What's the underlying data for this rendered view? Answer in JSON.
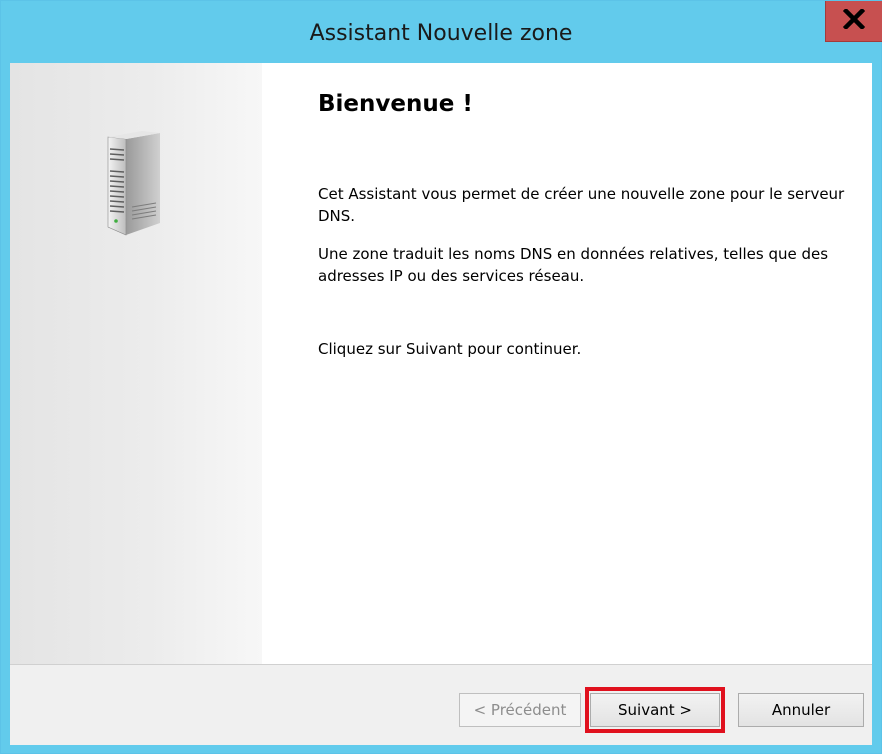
{
  "window": {
    "title": "Assistant Nouvelle zone",
    "close_glyph": "X"
  },
  "side_panel": {
    "icon": "server-icon"
  },
  "content": {
    "heading": "Bienvenue !",
    "paragraph_1": "Cet Assistant vous permet de créer une nouvelle zone pour le serveur DNS.",
    "paragraph_2": "Une zone traduit les noms DNS en données relatives, telles que des adresses IP ou des services réseau.",
    "paragraph_3": "Cliquez sur Suivant pour continuer."
  },
  "buttons": {
    "back_label": "< Précédent",
    "back_enabled": false,
    "next_label": "Suivant >",
    "cancel_label": "Annuler"
  },
  "colors": {
    "titlebar": "#62cbec",
    "close_button": "#c75050",
    "highlight_box": "#e0101d"
  }
}
